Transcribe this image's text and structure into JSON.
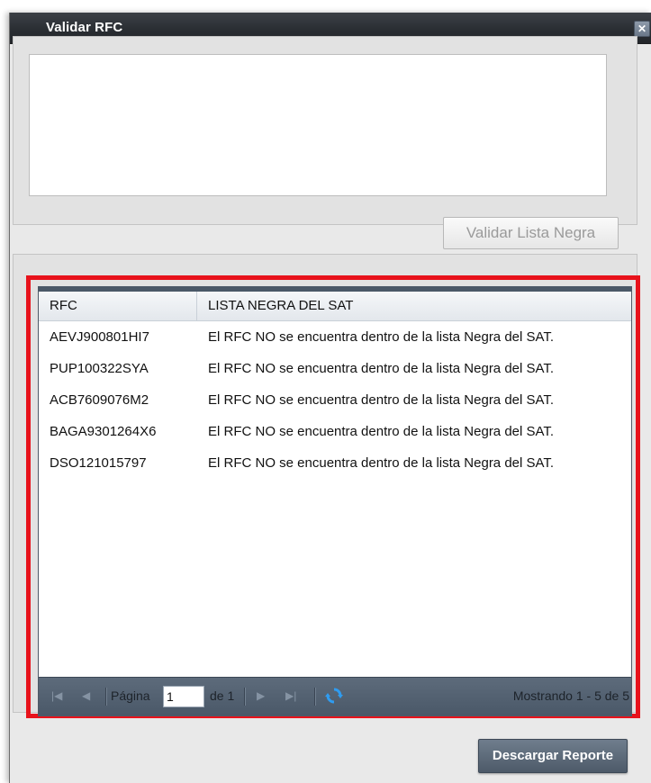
{
  "window": {
    "title": "Validar RFC"
  },
  "input": {
    "value": "",
    "placeholder": ""
  },
  "buttons": {
    "validar": "Validar Lista Negra",
    "descargar": "Descargar Reporte"
  },
  "grid": {
    "columns": [
      "RFC",
      "LISTA NEGRA DEL SAT"
    ],
    "rows": [
      {
        "rfc": "AEVJ900801HI7",
        "status": "El RFC NO se encuentra dentro de la lista Negra del SAT."
      },
      {
        "rfc": "PUP100322SYA",
        "status": "El RFC NO se encuentra dentro de la lista Negra del SAT."
      },
      {
        "rfc": "ACB7609076M2",
        "status": "El RFC NO se encuentra dentro de la lista Negra del SAT."
      },
      {
        "rfc": "BAGA9301264X6",
        "status": "El RFC NO se encuentra dentro de la lista Negra del SAT."
      },
      {
        "rfc": "DSO121015797",
        "status": "El RFC NO se encuentra dentro de la lista Negra del SAT."
      }
    ]
  },
  "pager": {
    "page_label": "Página",
    "page_value": "1",
    "of_label": "de 1",
    "info": "Mostrando 1 - 5 de 5"
  },
  "icons": {
    "close": "close-icon",
    "first": "first-page-icon",
    "prev": "prev-page-icon",
    "next": "next-page-icon",
    "last": "last-page-icon",
    "refresh": "refresh-icon"
  },
  "colors": {
    "titlebar": "#2a2e33",
    "highlight": "#e8121b",
    "pager": "#4a5868"
  }
}
